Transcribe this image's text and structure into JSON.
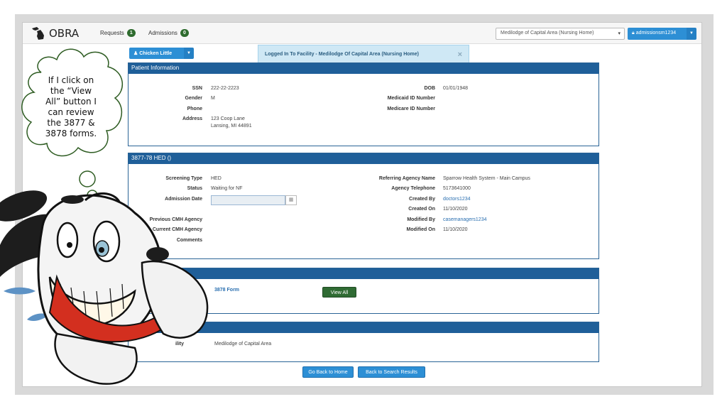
{
  "navbar": {
    "brand": "OBRA",
    "requests": {
      "label": "Requests",
      "count": "1"
    },
    "admissions": {
      "label": "Admissions",
      "count": "0"
    },
    "facility_select": "Medilodge of Capital Area (Nursing Home)",
    "user": "admissionsm1234"
  },
  "patient_button": "Chicken Little",
  "alert": {
    "message": "Logged In To Facility - Medilodge Of Capital Area (Nursing Home)",
    "close": "×"
  },
  "patient_info": {
    "heading": "Patient Information",
    "fields": {
      "ssn_label": "SSN",
      "ssn": "222-22-2223",
      "gender_label": "Gender",
      "gender": "M",
      "phone_label": "Phone",
      "phone": "",
      "address_label": "Address",
      "address": "123 Coop Lane\nLansing, MI 44891",
      "dob_label": "DOB",
      "dob": "01/01/1948",
      "medicaid_label": "Medicaid ID Number",
      "medicaid": "",
      "medicare_label": "Medicare ID Number",
      "medicare": ""
    }
  },
  "screening": {
    "heading": "3877-78 HED ()",
    "fields": {
      "screening_type_label": "Screening Type",
      "screening_type": "HED",
      "status_label": "Status",
      "status": "Waiting for NF",
      "admission_date_label": "Admission Date",
      "admission_date": "",
      "prev_cmh_label": "Previous CMH Agency",
      "prev_cmh": "",
      "curr_cmh_label": "Current CMH Agency",
      "curr_cmh": "",
      "comments_label": "Comments",
      "comments": "",
      "referring_label": "Referring Agency Name",
      "referring": "Sparrow Health System - Main Campus",
      "agency_tel_label": "Agency Telephone",
      "agency_tel": "5173641000",
      "created_by_label": "Created By",
      "created_by": "doctors1234",
      "created_on_label": "Created On",
      "created_on": "11/10/2020",
      "modified_by_label": "Modified By",
      "modified_by": "casemanagers1234",
      "modified_on_label": "Modified On",
      "modified_on": "11/10/2020"
    }
  },
  "forms": {
    "heading_visible": "ms",
    "link1_visible": "orm",
    "link2": "3878 Form",
    "view_all": "View All"
  },
  "facility": {
    "label_visible": "ility",
    "value": "Medilodge of Capital Area"
  },
  "footer": {
    "home": "Go Back to Home",
    "search": "Back to Search Results"
  },
  "annotation": {
    "thought": "If I click on the “View All” button I can review the 3877 & 3878 forms."
  },
  "colors": {
    "primary": "#2d8fd5",
    "panel_header": "#1f5f99",
    "success": "#2f6b33",
    "link": "#2a6fb0"
  }
}
